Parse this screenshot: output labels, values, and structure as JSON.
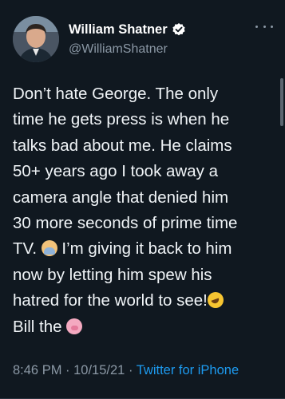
{
  "tweet": {
    "author": {
      "display_name": "William Shatner",
      "handle": "@WilliamShatner",
      "verified": true,
      "avatar_icon": "profile-photo"
    },
    "more_icon": "more-horizontal-icon",
    "lines": [
      "Don’t hate George. The only",
      "time he gets press is when he",
      "talks bad about me.  He claims",
      "50+ years ago I took away a",
      "camera angle that denied him",
      "30 more seconds of prime time"
    ],
    "line7_before": "TV. ",
    "line7_after": " I’m giving it back to him",
    "line8": "now by letting him spew his",
    "line9": "hatred for the world to see!",
    "line10": "Bill the ",
    "emoji": {
      "shrug": "man-shrugging-emoji",
      "rofl": "rolling-on-floor-laughing-emoji",
      "pig": "pig-face-emoji"
    },
    "meta": {
      "time": "8:46 PM",
      "separator1": " · ",
      "date": "10/15/21",
      "separator2": " · ",
      "source": "Twitter for iPhone"
    }
  },
  "colors": {
    "background": "#101820",
    "text": "#f0f4f7",
    "secondary": "#8b98a5",
    "link": "#1d9bf0",
    "verified": "#ffffff"
  }
}
